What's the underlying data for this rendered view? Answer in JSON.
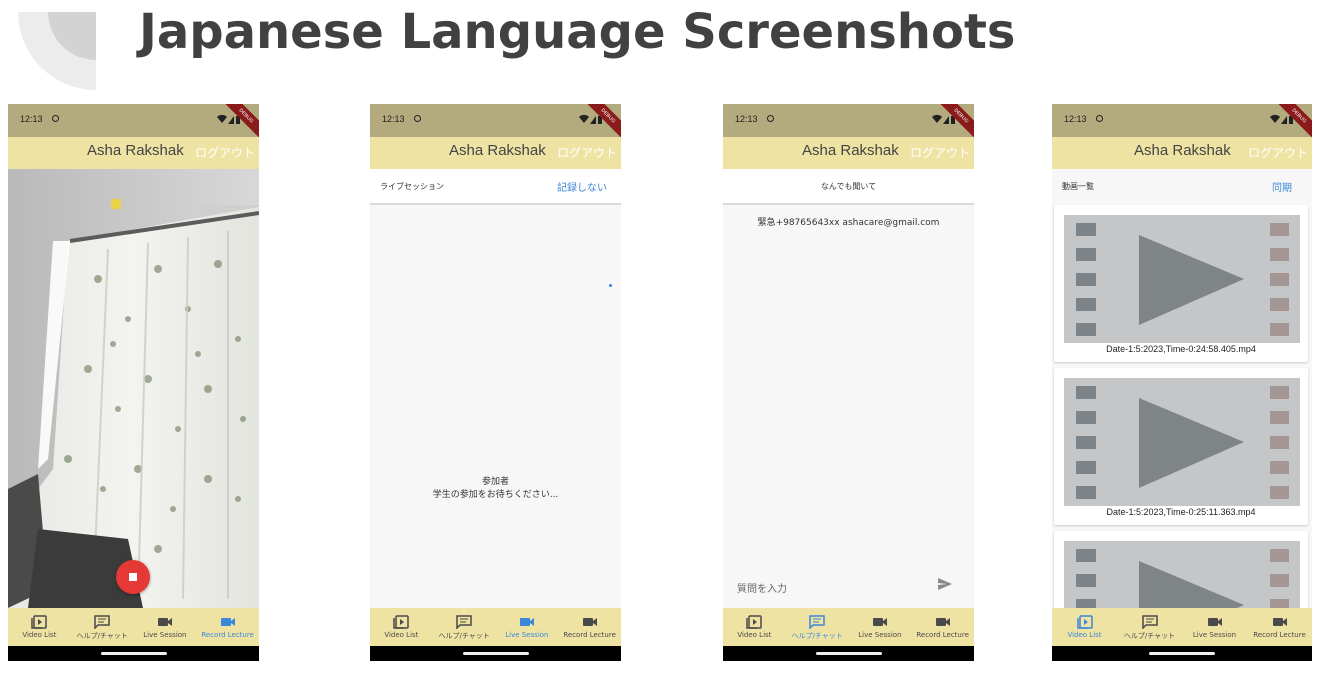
{
  "title": "Japanese Language Screenshots",
  "status_bar": {
    "time": "12:13",
    "debug_ribbon": "DEBUG"
  },
  "app_bar": {
    "title": "Asha Rakshak",
    "logout": "ログアウト"
  },
  "bottom_nav": {
    "video_list": "Video List",
    "help_chat": "ヘルプ/チャット",
    "live_session": "Live Session",
    "record_lecture": "Record Lecture"
  },
  "screens": {
    "record": {
      "active_tab": "Record Lecture"
    },
    "live": {
      "header": "ライブセッション",
      "action": "記録しない",
      "participants_label": "参加者",
      "waiting_message": "学生の参加をお待ちください...",
      "active_tab": "Live Session"
    },
    "chat": {
      "header": "なんでも聞いて",
      "contact": "緊急+98765643xx ashacare@gmail.com",
      "input_placeholder": "質問を入力",
      "active_tab": "ヘルプ/チャット"
    },
    "videos": {
      "header": "動画一覧",
      "sync": "同期",
      "items": [
        {
          "name": "Date-1:5:2023,Time-0:24:58.405.mp4"
        },
        {
          "name": "Date-1:5:2023,Time-0:25:11.363.mp4"
        },
        {
          "name": ""
        }
      ],
      "active_tab": "Video List"
    }
  },
  "colors": {
    "status_bar": "#b3ab7e",
    "app_bar": "#efe3a4",
    "accent_blue": "#3b87d9",
    "record_red": "#e53935",
    "title_text": "#414141"
  },
  "icons": [
    "video-list-icon",
    "chat-icon",
    "videocam-icon",
    "record-video-icon",
    "send-icon",
    "play-icon",
    "stop-icon"
  ]
}
